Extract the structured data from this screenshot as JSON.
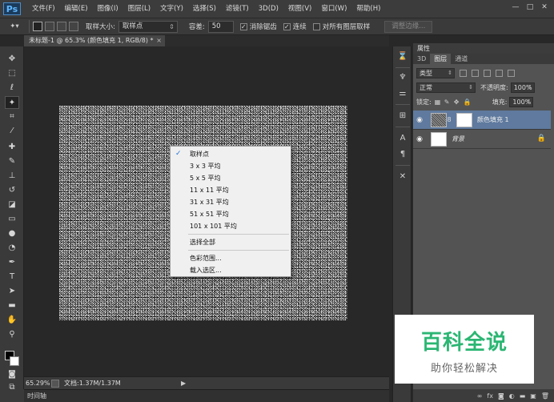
{
  "app": {
    "logo": "Ps",
    "menu": [
      "文件(F)",
      "编辑(E)",
      "图像(I)",
      "图层(L)",
      "文字(Y)",
      "选择(S)",
      "滤镜(T)",
      "3D(D)",
      "视图(V)",
      "窗口(W)",
      "帮助(H)"
    ],
    "window_controls": [
      "—",
      "□",
      "✕"
    ]
  },
  "options": {
    "sample_size_label": "取样大小:",
    "sample_size_value": "取样点",
    "tolerance_label": "容差:",
    "tolerance_value": "50",
    "antialias_label": "消除锯齿",
    "contiguous_label": "连续",
    "all_layers_label": "对所有图层取样",
    "refine_edge_label": "调整边缘..."
  },
  "document": {
    "tab_title": "未标题-1 @ 65.3% (颜色填充 1, RGB/8) *",
    "close": "×"
  },
  "context_menu": {
    "items": [
      "取样点",
      "3 x 3 平均",
      "5 x 5 平均",
      "11 x 11 平均",
      "31 x 31 平均",
      "51 x 51 平均",
      "101 x 101 平均"
    ],
    "select_all": "选择全部",
    "color_range": "色彩范围...",
    "load_selection": "载入选区...",
    "checked_mark": "✓"
  },
  "status": {
    "zoom": "65.29%",
    "doc_info": "文档:1.37M/1.37M",
    "arrow": "▶"
  },
  "timeline": {
    "label": "时间轴"
  },
  "panels": {
    "properties_label": "属性",
    "tabs": [
      "3D",
      "图层",
      "通道"
    ],
    "filter_kind": "类型",
    "blend_mode": "正常",
    "opacity_label": "不透明度:",
    "opacity_value": "100%",
    "lock_label": "锁定:",
    "fill_label": "填充:",
    "fill_value": "100%",
    "layers": [
      {
        "name": "颜色填充 1",
        "selected": true
      },
      {
        "name": "背景",
        "selected": false
      }
    ],
    "footer_icons": [
      "∞",
      "fx",
      "◙",
      "◐",
      "▬",
      "▣",
      "🗑"
    ]
  },
  "watermark": {
    "title": "百科全说",
    "subtitle": "助你轻松解决"
  }
}
